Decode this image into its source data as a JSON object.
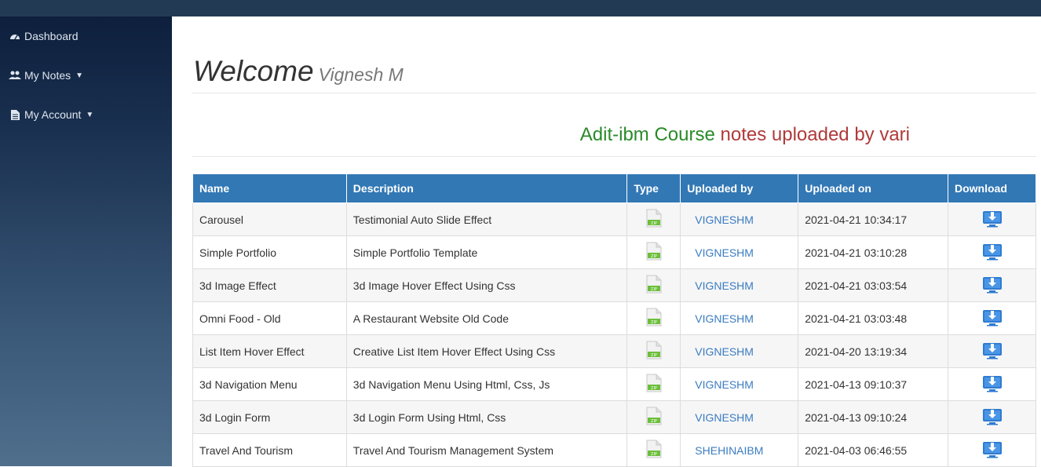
{
  "sidebar": {
    "items": [
      {
        "label": "Dashboard",
        "icon": "dashboard-icon"
      },
      {
        "label": "My Notes",
        "icon": "users-icon"
      },
      {
        "label": "My Account",
        "icon": "document-icon"
      }
    ]
  },
  "main": {
    "welcome": "Welcome",
    "username": "Vignesh M",
    "heading_course": "Adit-ibm Course",
    "heading_rest": "notes uploaded by vari"
  },
  "table": {
    "headers": [
      "Name",
      "Description",
      "Type",
      "Uploaded by",
      "Uploaded on",
      "Download"
    ],
    "rows": [
      {
        "name": "Carousel",
        "description": "Testimonial Auto Slide Effect",
        "uploaded_by": "VIGNESHM",
        "uploaded_on": "2021-04-21 10:34:17"
      },
      {
        "name": "Simple Portfolio",
        "description": "Simple Portfolio Template",
        "uploaded_by": "VIGNESHM",
        "uploaded_on": "2021-04-21 03:10:28"
      },
      {
        "name": "3d Image Effect",
        "description": "3d Image Hover Effect Using Css",
        "uploaded_by": "VIGNESHM",
        "uploaded_on": "2021-04-21 03:03:54"
      },
      {
        "name": "Omni Food - Old",
        "description": "A Restaurant Website Old Code",
        "uploaded_by": "VIGNESHM",
        "uploaded_on": "2021-04-21 03:03:48"
      },
      {
        "name": "List Item Hover Effect",
        "description": "Creative List Item Hover Effect Using Css",
        "uploaded_by": "VIGNESHM",
        "uploaded_on": "2021-04-20 13:19:34"
      },
      {
        "name": "3d Navigation Menu",
        "description": "3d Navigation Menu Using Html, Css, Js",
        "uploaded_by": "VIGNESHM",
        "uploaded_on": "2021-04-13 09:10:37"
      },
      {
        "name": "3d Login Form",
        "description": "3d Login Form Using Html, Css",
        "uploaded_by": "VIGNESHM",
        "uploaded_on": "2021-04-13 09:10:24"
      },
      {
        "name": "Travel And Tourism",
        "description": "Travel And Tourism Management System",
        "uploaded_by": "SHEHINAIBM",
        "uploaded_on": "2021-04-03 06:46:55"
      }
    ],
    "type_icon": "zip-file-icon",
    "download_icon": "download-icon"
  },
  "colors": {
    "header_bg": "#3278b5",
    "course_green": "#2a8a2a",
    "heading_red": "#b03a3a",
    "link_blue": "#3a7cc1"
  }
}
